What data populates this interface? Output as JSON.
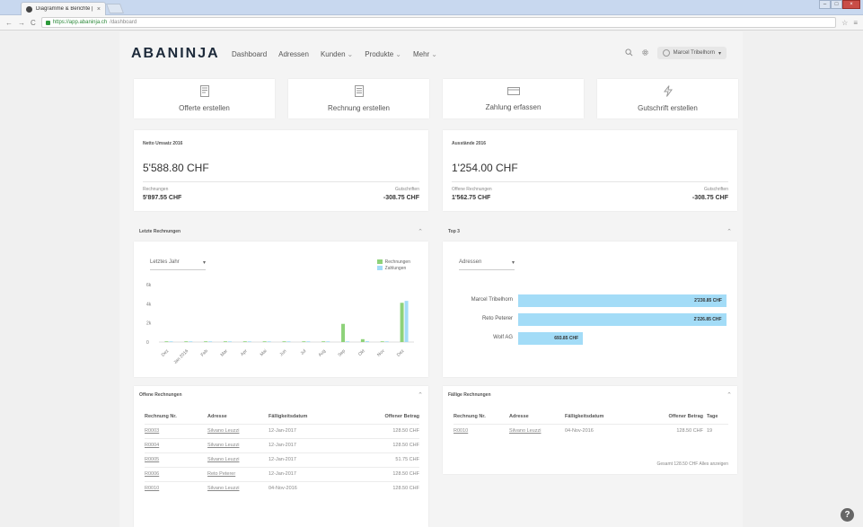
{
  "browser": {
    "tab_title": "Diagramme & Berichte |",
    "tab_close": "×",
    "url_secure": "https://app.abaninja.ch",
    "url_path": "/dashboard",
    "back": "←",
    "forward": "→",
    "reload": "C",
    "star": "☆",
    "menu": "≡",
    "minimize": "–",
    "maximize": "□",
    "close": "×"
  },
  "header": {
    "logo": "ABANINJA",
    "nav": [
      {
        "label": "Dashboard"
      },
      {
        "label": "Adressen"
      },
      {
        "label": "Kunden",
        "caret": "⌄"
      },
      {
        "label": "Produkte",
        "caret": "⌄"
      },
      {
        "label": "Mehr",
        "caret": "⌄"
      }
    ],
    "user_name": "Marcel Tribelhorn",
    "user_caret": "▾"
  },
  "actions": [
    {
      "label": "Offerte erstellen",
      "icon": "offer-icon"
    },
    {
      "label": "Rechnung erstellen",
      "icon": "invoice-icon"
    },
    {
      "label": "Zahlung erfassen",
      "icon": "payment-icon"
    },
    {
      "label": "Gutschrift erstellen",
      "icon": "lightning-icon"
    }
  ],
  "stats": {
    "netto": {
      "title": "Netto Umsatz 2016",
      "value": "5'588.80 CHF",
      "left_label": "Rechnungen",
      "left_value": "5'897.55 CHF",
      "right_label": "Gutschriften",
      "right_value": "-308.75 CHF"
    },
    "ausstaende": {
      "title": "Ausstände 2016",
      "value": "1'254.00 CHF",
      "left_label": "Offene Rechnungen",
      "left_value": "1'562.75 CHF",
      "right_label": "Gutschriften",
      "right_value": "-308.75 CHF"
    }
  },
  "recent_invoices": {
    "title": "Letzte Rechnungen",
    "period": "Letztes Jahr",
    "caret": "⌃"
  },
  "top3": {
    "title": "Top 3",
    "filter": "Adressen",
    "caret": "⌃",
    "items": [
      {
        "name": "Marcel Tribelhorn",
        "label": "2'230.85 CHF",
        "value": 2230.85
      },
      {
        "name": "Reto Peterer",
        "label": "2'226.85 CHF",
        "value": 2226.85
      },
      {
        "name": "Wolf AG",
        "label": "693.85 CHF",
        "value": 693.85
      }
    ]
  },
  "chart_data": {
    "type": "bar",
    "categories": [
      "Dez",
      "Jan 2016",
      "Feb",
      "Mar",
      "Apr",
      "Mai",
      "Jun",
      "Jul",
      "Aug",
      "Sep",
      "Okt",
      "Nov",
      "Dez"
    ],
    "series": [
      {
        "name": "Rechnungen",
        "color": "#8ed27a",
        "values": [
          0,
          0,
          0,
          0,
          0,
          0,
          0,
          0,
          0,
          1.9,
          0.3,
          0,
          4.1
        ]
      },
      {
        "name": "Zahlungen",
        "color": "#a3dcf7",
        "values": [
          0,
          0,
          0,
          0,
          0,
          0,
          0,
          0,
          0,
          0,
          0.1,
          0,
          4.3
        ]
      }
    ],
    "yticks": [
      "0",
      "2k",
      "4k",
      "6k"
    ],
    "ylim": [
      0,
      6
    ]
  },
  "open_invoices": {
    "title": "Offene Rechnungen",
    "caret": "⌃",
    "columns": [
      "Rechnung Nr.",
      "Adresse",
      "Fälligkeitsdatum",
      "Offener Betrag"
    ],
    "rows": [
      [
        "R0003",
        "Silvano Leuzzi",
        "12-Jan-2017",
        "128.50 CHF"
      ],
      [
        "R0004",
        "Silvano Leuzzi",
        "12-Jan-2017",
        "128.50 CHF"
      ],
      [
        "R0005",
        "Silvano Leuzzi",
        "12-Jan-2017",
        "51.75 CHF"
      ],
      [
        "R0006",
        "Reto Peterer",
        "12-Jan-2017",
        "128.50 CHF"
      ],
      [
        "R0010",
        "Silvano Leuzzi",
        "04-Nov-2016",
        "128.50 CHF"
      ]
    ]
  },
  "due_invoices": {
    "title": "Fällige Rechnungen",
    "caret": "⌃",
    "columns": [
      "Rechnung Nr.",
      "Adresse",
      "Fälligkeitsdatum",
      "Offener Betrag",
      "Tage"
    ],
    "rows": [
      [
        "R0010",
        "Silvano Leuzzi",
        "04-Nov-2016",
        "128.50 CHF",
        "19"
      ]
    ],
    "footer": "Gesamt 128.50 CHF  Alles anzeigen"
  },
  "help": "?"
}
